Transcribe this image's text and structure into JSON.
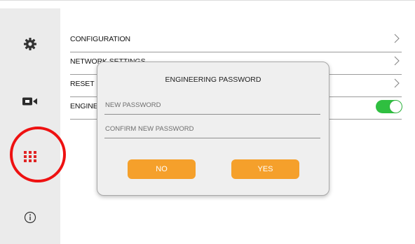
{
  "sidebar": {
    "items": [
      {
        "icon": "gear-icon"
      },
      {
        "icon": "video-camera-icon"
      },
      {
        "icon": "apps-grid-icon",
        "color": "#e02424",
        "selected": true
      },
      {
        "icon": "info-icon"
      }
    ]
  },
  "settings": {
    "rows": [
      {
        "label": "CONFIGURATION"
      },
      {
        "label": "NETWORK SETTINGS"
      },
      {
        "label": "RESET"
      },
      {
        "label": "ENGINEERING MODE",
        "toggle": true
      }
    ]
  },
  "dialog": {
    "title": "ENGINEERING PASSWORD",
    "new_password": {
      "placeholder": "NEW PASSWORD",
      "value": ""
    },
    "confirm_password": {
      "placeholder": "CONFIRM NEW PASSWORD",
      "value": ""
    },
    "no_label": "NO",
    "yes_label": "YES"
  },
  "colors": {
    "accent": "#f5a02b",
    "toggle_on": "#2fbf40",
    "selected_icon": "#e02424",
    "highlight": "#ee1111"
  }
}
